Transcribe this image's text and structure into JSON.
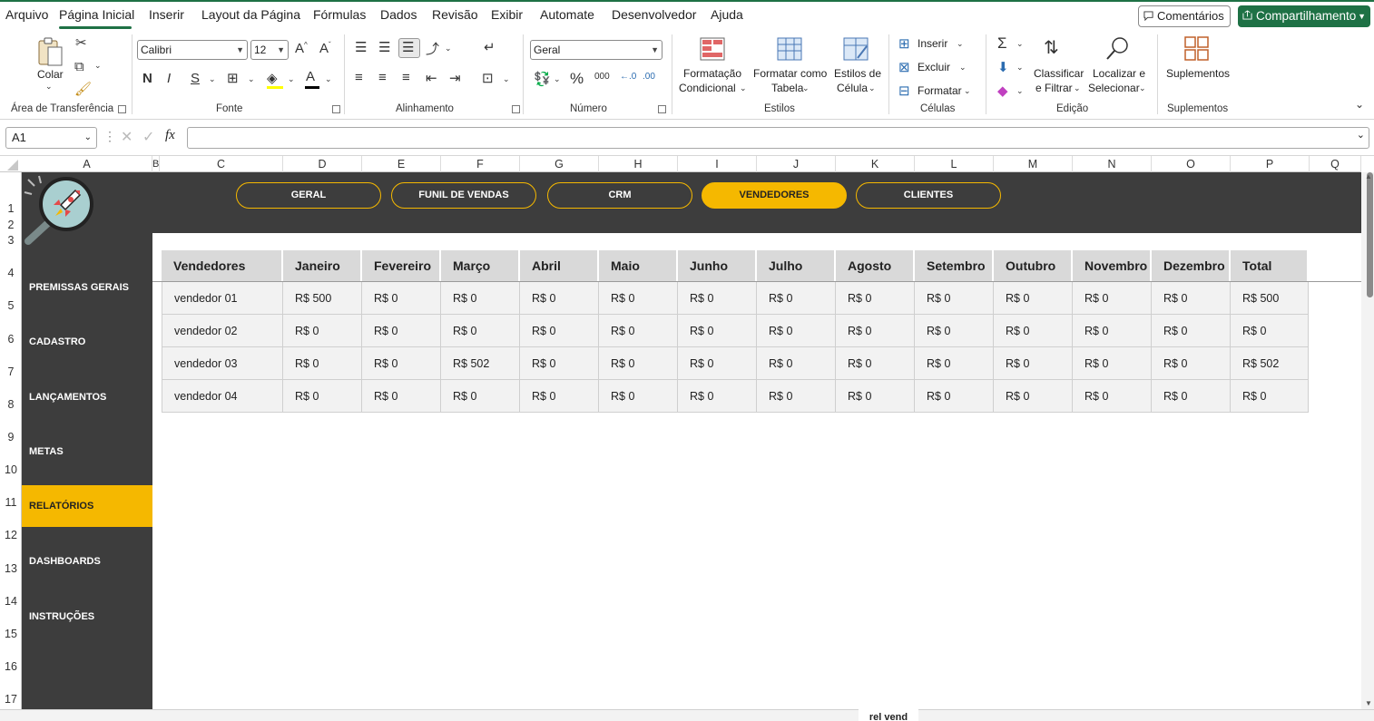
{
  "menu": {
    "items": [
      "Arquivo",
      "Página Inicial",
      "Inserir",
      "Layout da Página",
      "Fórmulas",
      "Dados",
      "Revisão",
      "Exibir",
      "Automate",
      "Desenvolvedor",
      "Ajuda"
    ],
    "comments_label": "Comentários",
    "share_label": "Compartilhamento"
  },
  "ribbon": {
    "clipboard": {
      "paste": "Colar",
      "label": "Área de Transferência"
    },
    "font": {
      "name": "Calibri",
      "size": "12",
      "label": "Fonte",
      "bold": "N",
      "italic": "I",
      "underline": "S"
    },
    "alignment": {
      "label": "Alinhamento"
    },
    "number": {
      "format": "Geral",
      "label": "Número"
    },
    "styles": {
      "conditional_1": "Formatação",
      "conditional_2": "Condicional",
      "table_1": "Formatar como",
      "table_2": "Tabela",
      "cell_1": "Estilos de",
      "cell_2": "Célula",
      "label": "Estilos"
    },
    "cells": {
      "insert": "Inserir",
      "delete": "Excluir",
      "format": "Formatar",
      "label": "Células"
    },
    "editing": {
      "sort_1": "Classificar",
      "sort_2": "e Filtrar",
      "find_1": "Localizar e",
      "find_2": "Selecionar",
      "label": "Edição"
    },
    "addins": {
      "button": "Suplementos",
      "label": "Suplementos"
    }
  },
  "formula_bar": {
    "name_box": "A1",
    "fx": "fx",
    "value": ""
  },
  "columns": [
    "A",
    "B",
    "C",
    "D",
    "E",
    "F",
    "G",
    "H",
    "I",
    "J",
    "K",
    "L",
    "M",
    "N",
    "O",
    "P",
    "Q"
  ],
  "rows": [
    "1",
    "2",
    "3",
    "4",
    "5",
    "6",
    "7",
    "8",
    "9",
    "10",
    "11",
    "12",
    "13",
    "14",
    "15",
    "16",
    "17"
  ],
  "top_nav": [
    "GERAL",
    "FUNIL DE VENDAS",
    "CRM",
    "VENDEDORES",
    "CLIENTES"
  ],
  "top_nav_active": "VENDEDORES",
  "side_nav": [
    "PREMISSAS GERAIS",
    "CADASTRO",
    "LANÇAMENTOS",
    "METAS",
    "RELATÓRIOS",
    "DASHBOARDS",
    "INSTRUÇÕES"
  ],
  "side_nav_active": "RELATÓRIOS",
  "table": {
    "headers": [
      "Vendedores",
      "Janeiro",
      "Fevereiro",
      "Março",
      "Abril",
      "Maio",
      "Junho",
      "Julho",
      "Agosto",
      "Setembro",
      "Outubro",
      "Novembro",
      "Dezembro",
      "Total"
    ],
    "rows": [
      [
        "vendedor 01",
        "R$ 500",
        "R$ 0",
        "R$ 0",
        "R$ 0",
        "R$ 0",
        "R$ 0",
        "R$ 0",
        "R$ 0",
        "R$ 0",
        "R$ 0",
        "R$ 0",
        "R$ 0",
        "R$ 500"
      ],
      [
        "vendedor 02",
        "R$ 0",
        "R$ 0",
        "R$ 0",
        "R$ 0",
        "R$ 0",
        "R$ 0",
        "R$ 0",
        "R$ 0",
        "R$ 0",
        "R$ 0",
        "R$ 0",
        "R$ 0",
        "R$ 0"
      ],
      [
        "vendedor 03",
        "R$ 0",
        "R$ 0",
        "R$ 502",
        "R$ 0",
        "R$ 0",
        "R$ 0",
        "R$ 0",
        "R$ 0",
        "R$ 0",
        "R$ 0",
        "R$ 0",
        "R$ 0",
        "R$ 502"
      ],
      [
        "vendedor 04",
        "R$ 0",
        "R$ 0",
        "R$ 0",
        "R$ 0",
        "R$ 0",
        "R$ 0",
        "R$ 0",
        "R$ 0",
        "R$ 0",
        "R$ 0",
        "R$ 0",
        "R$ 0",
        "R$ 0"
      ]
    ]
  },
  "sheet_tabs": {
    "active": "rel vend"
  },
  "colors": {
    "accent": "#f5b800",
    "dark": "#3d3d3d",
    "excel_green": "#1e7145"
  }
}
